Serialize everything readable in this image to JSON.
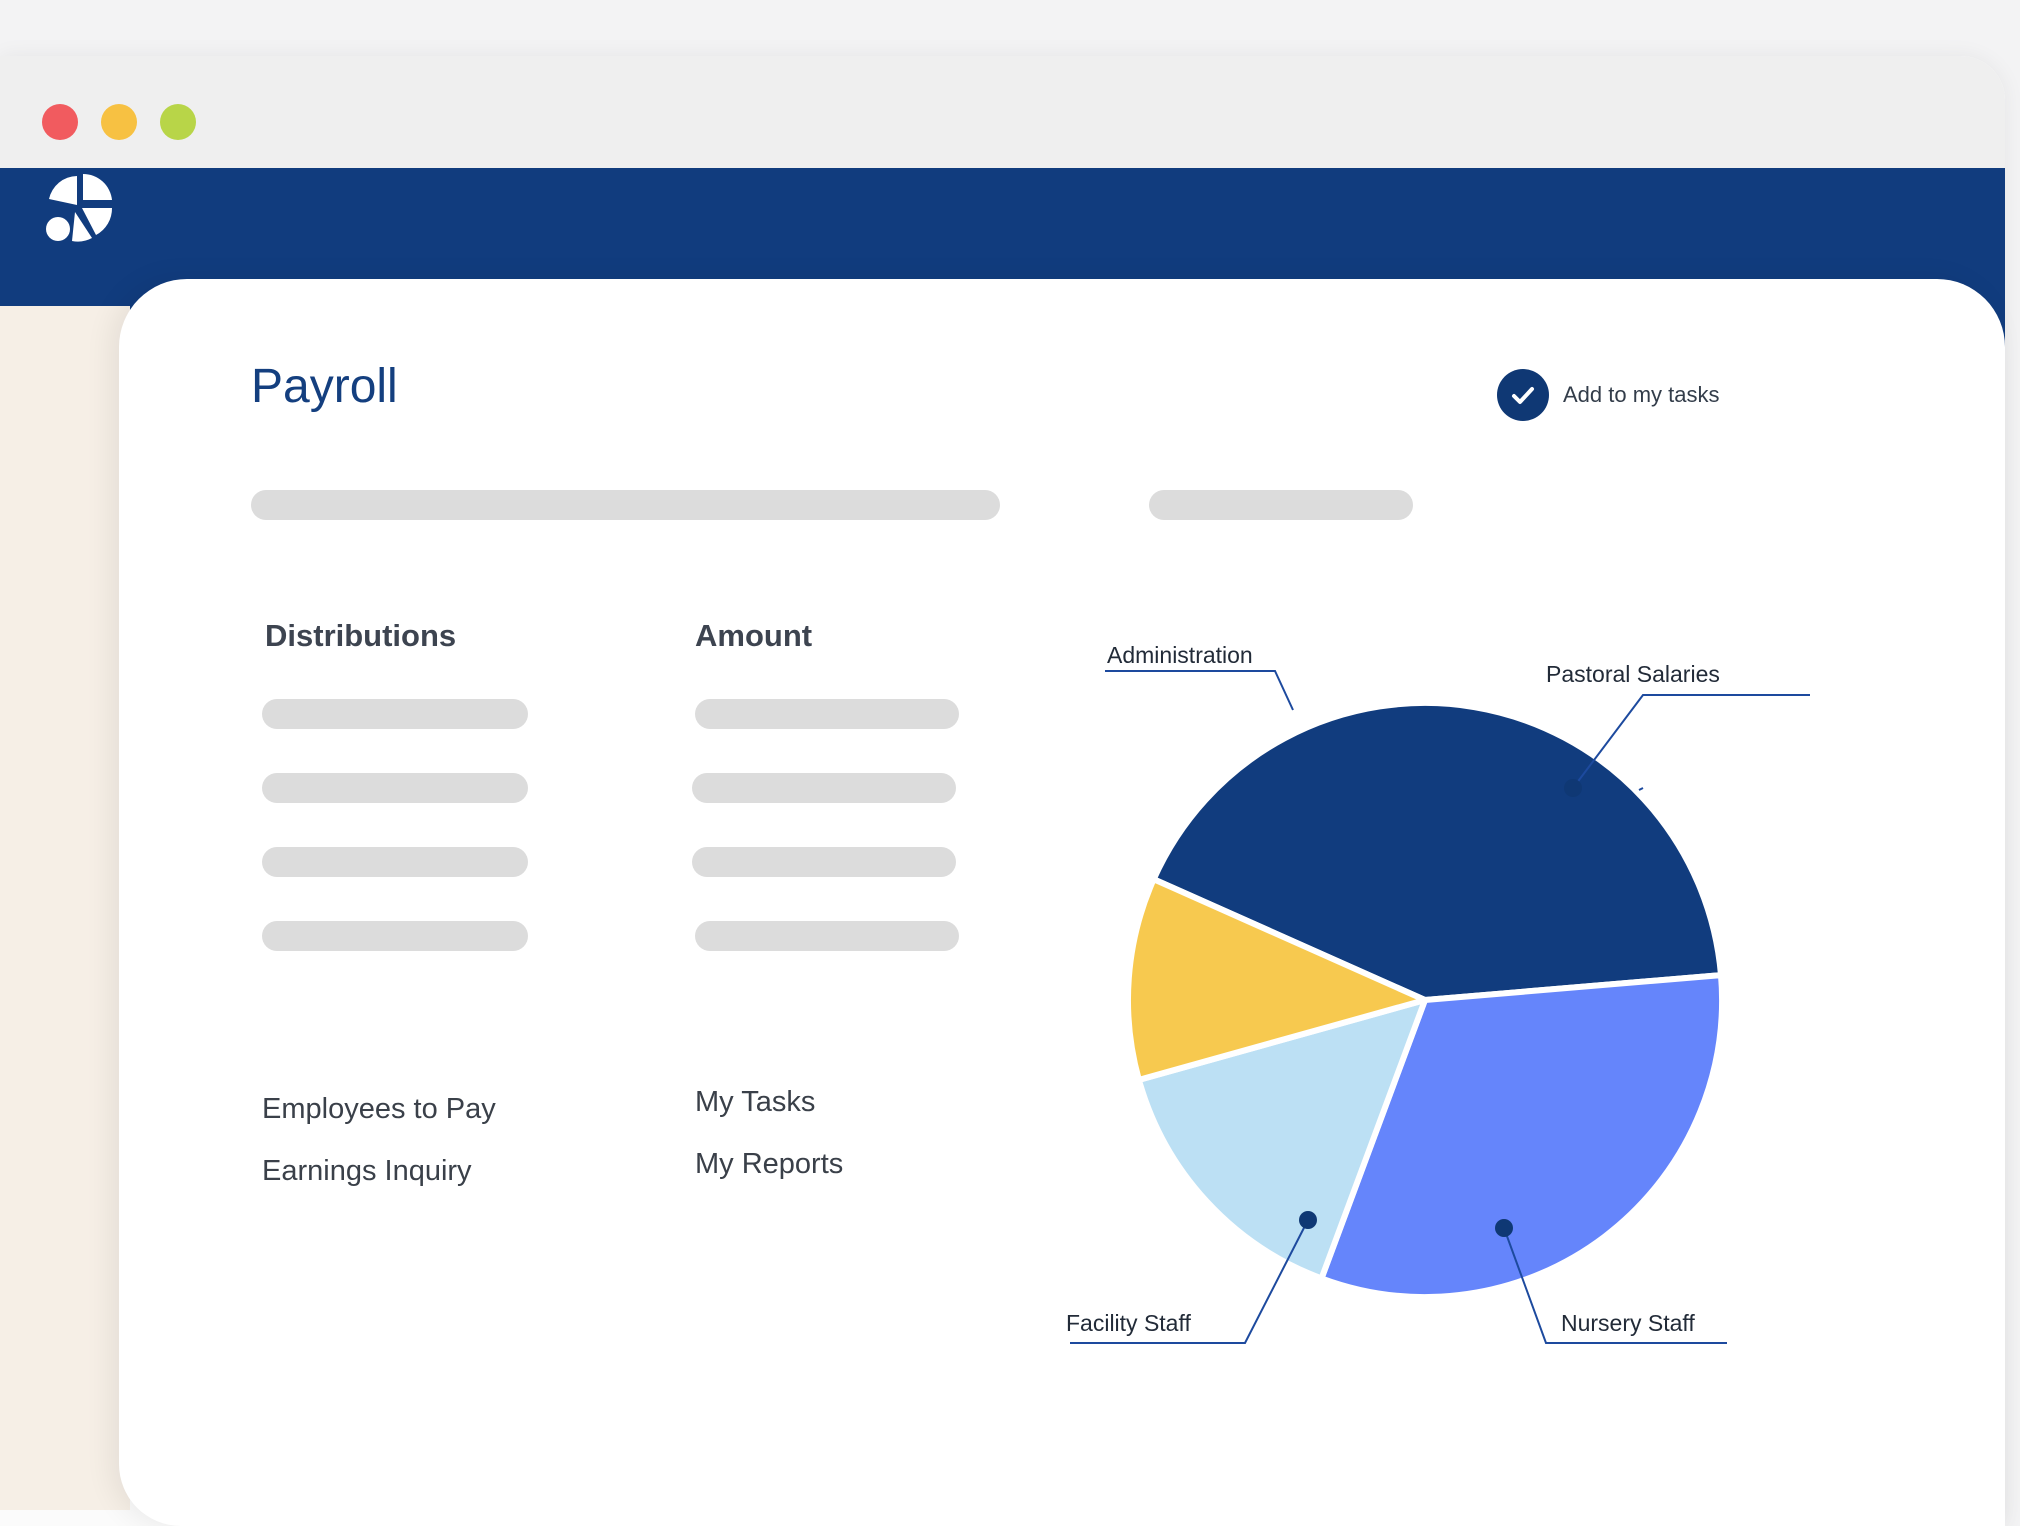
{
  "window": {
    "controls": [
      {
        "name": "close",
        "color": "#f15b5f"
      },
      {
        "name": "minimize",
        "color": "#f7c142"
      },
      {
        "name": "maximize",
        "color": "#b8d548"
      }
    ]
  },
  "header": {
    "logo_icon": "pie-logo-icon",
    "brand_color": "#113c7e"
  },
  "page": {
    "title": "Payroll",
    "add_task": {
      "label": "Add to my tasks",
      "icon": "check-circle-icon"
    }
  },
  "table": {
    "columns": [
      "Distributions",
      "Amount"
    ],
    "row_count": 4
  },
  "links": {
    "left": [
      "Employees to Pay",
      "Earnings Inquiry"
    ],
    "right": [
      "My Tasks",
      "My Reports"
    ]
  },
  "chart_data": {
    "type": "pie",
    "title": "",
    "slices": [
      {
        "label": "Administration",
        "value": 42,
        "color": "#113c7e"
      },
      {
        "label": "Pastoral Salaries",
        "value": 32,
        "color": "#6585fb"
      },
      {
        "label": "Nursery Staff",
        "value": 15,
        "color": "#bce0f4"
      },
      {
        "label": "Facility Staff",
        "value": 11,
        "color": "#f7c94f"
      }
    ],
    "legend": "callout labels"
  }
}
